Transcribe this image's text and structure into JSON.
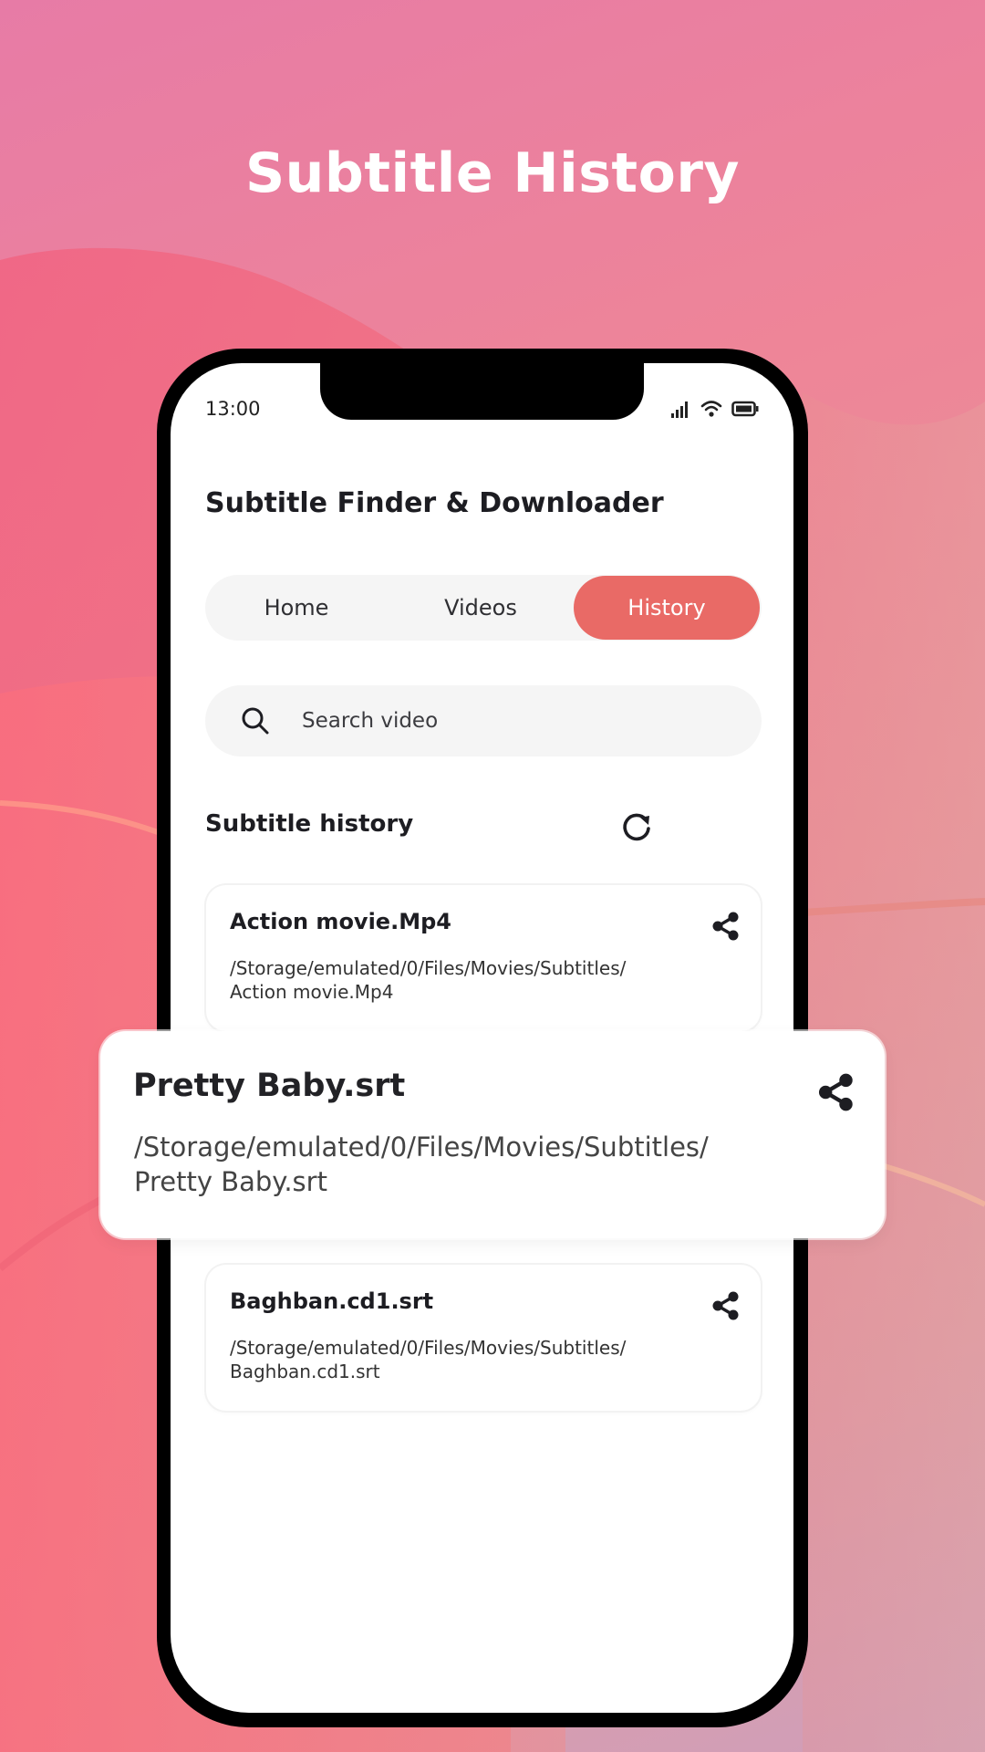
{
  "headline": "Subtitle History",
  "colors": {
    "accent": "#E96A66",
    "text_dark": "#1d1d22",
    "surface": "#f5f5f5",
    "phone_frame": "#000000"
  },
  "status_bar": {
    "time": "13:00",
    "icons": [
      "signal-icon",
      "wifi-icon",
      "battery-icon"
    ]
  },
  "app": {
    "title": "Subtitle Finder & Downloader",
    "tabs": [
      {
        "label": "Home",
        "active": false
      },
      {
        "label": "Videos",
        "active": false
      },
      {
        "label": "History",
        "active": true
      }
    ],
    "search": {
      "placeholder": "Search video",
      "value": "",
      "icon": "search-icon"
    },
    "section": {
      "title": "Subtitle history",
      "action_icon": "refresh-icon"
    },
    "history": [
      {
        "name": "Action movie.Mp4",
        "path": "/Storage/emulated/0/Files/Movies/Subtitles/ Action movie.Mp4",
        "icon": "share-icon"
      },
      {
        "name": "Pretty Baby.srt",
        "path": "/Storage/emulated/0/Files/Movies/Subtitles/ Pretty Baby.srt",
        "icon": "share-icon",
        "highlighted": true
      },
      {
        "name": "Baghban.cd1.srt",
        "path": "/Storage/emulated/0/Files/Movies/Subtitles/ Baghban.cd1.srt",
        "icon": "share-icon"
      }
    ]
  }
}
